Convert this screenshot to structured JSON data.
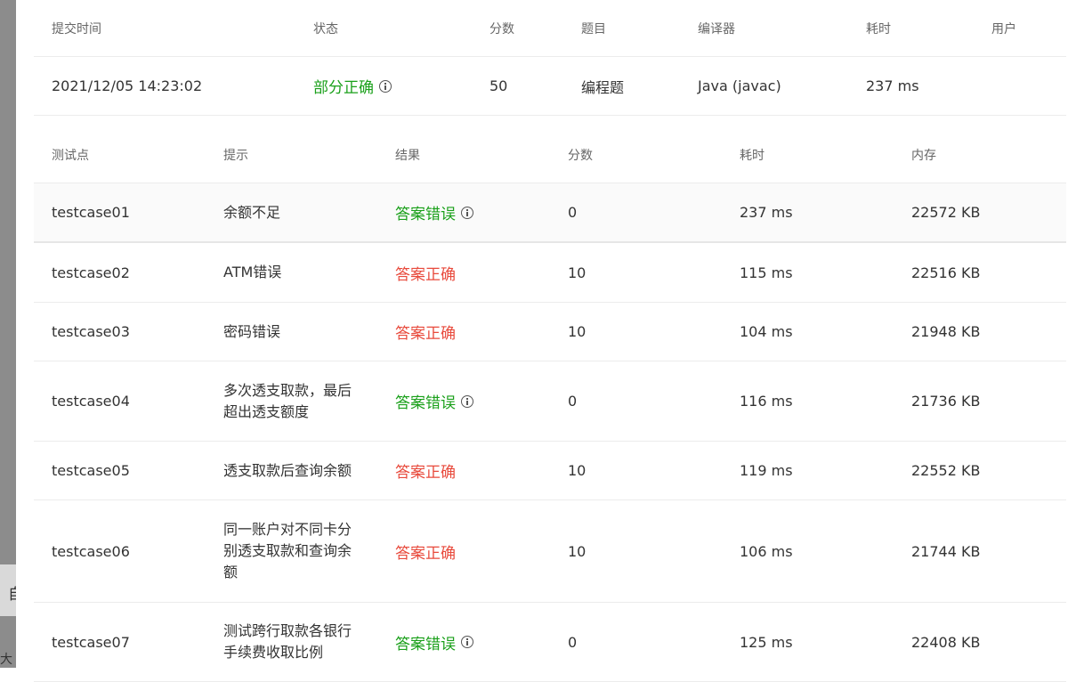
{
  "background": {
    "peek_char": "自",
    "corner_char": "大"
  },
  "submission": {
    "headers": {
      "time": "提交时间",
      "status": "状态",
      "score": "分数",
      "problem": "题目",
      "compiler": "编译器",
      "runtime": "耗时",
      "user": "用户"
    },
    "row": {
      "time": "2021/12/05 14:23:02",
      "status": "部分正确",
      "status_color": "#1aa01a",
      "score": "50",
      "problem": "编程题",
      "compiler": "Java (javac)",
      "runtime": "237 ms",
      "user": ""
    }
  },
  "testcases": {
    "headers": {
      "case": "测试点",
      "hint": "提示",
      "result": "结果",
      "score": "分数",
      "runtime": "耗时",
      "memory": "内存"
    },
    "rows": [
      {
        "case": "testcase01",
        "hint_lines": [
          "余额不足"
        ],
        "result": "答案错误",
        "result_type": "wrong",
        "score": "0",
        "runtime": "237 ms",
        "memory": "22572 KB"
      },
      {
        "case": "testcase02",
        "hint_lines": [
          "ATM错误"
        ],
        "result": "答案正确",
        "result_type": "correct",
        "score": "10",
        "runtime": "115 ms",
        "memory": "22516 KB"
      },
      {
        "case": "testcase03",
        "hint_lines": [
          "密码错误"
        ],
        "result": "答案正确",
        "result_type": "correct",
        "score": "10",
        "runtime": "104 ms",
        "memory": "21948 KB"
      },
      {
        "case": "testcase04",
        "hint_lines": [
          "多次透支取款，最后",
          "超出透支额度"
        ],
        "result": "答案错误",
        "result_type": "wrong",
        "score": "0",
        "runtime": "116 ms",
        "memory": "21736 KB"
      },
      {
        "case": "testcase05",
        "hint_lines": [
          "透支取款后查询余额"
        ],
        "result": "答案正确",
        "result_type": "correct",
        "score": "10",
        "runtime": "119 ms",
        "memory": "22552 KB"
      },
      {
        "case": "testcase06",
        "hint_lines": [
          "同一账户对不同卡分",
          "别透支取款和查询余",
          "额"
        ],
        "result": "答案正确",
        "result_type": "correct",
        "score": "10",
        "runtime": "106 ms",
        "memory": "21744 KB"
      },
      {
        "case": "testcase07",
        "hint_lines": [
          "测试跨行取款各银行",
          "手续费收取比例"
        ],
        "result": "答案错误",
        "result_type": "wrong",
        "score": "0",
        "runtime": "125 ms",
        "memory": "22408 KB"
      }
    ]
  },
  "colors": {
    "wrong_answer": "#1aa01a",
    "correct_answer": "#e84a3c"
  }
}
